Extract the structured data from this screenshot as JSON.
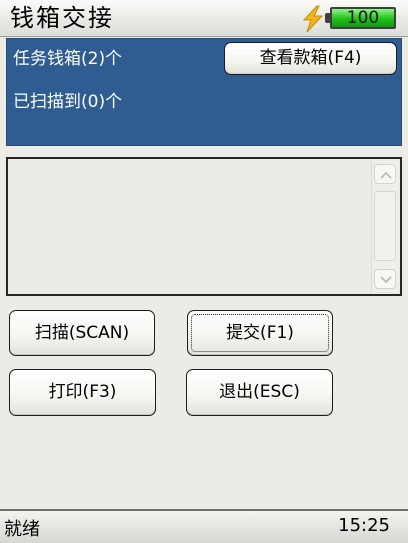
{
  "window": {
    "title": "钱箱交接"
  },
  "battery": {
    "level_text": "100",
    "level_percent": 100
  },
  "summary": {
    "task_boxes_label": "任务钱箱(2)个",
    "scanned_label": "已扫描到(0)个",
    "view_boxes_button": "查看款箱(F4)"
  },
  "actions": {
    "scan": "扫描(SCAN)",
    "submit": "提交(F1)",
    "print": "打印(F3)",
    "exit": "退出(ESC)"
  },
  "status": {
    "state": "就绪",
    "time": "15:25"
  },
  "colors": {
    "panel": "#2f5d92",
    "battery_fill": "#1fc01a",
    "bolt": "#f3b61a"
  },
  "icons": {
    "charging": "lightning-bolt-icon",
    "battery": "battery-icon"
  }
}
